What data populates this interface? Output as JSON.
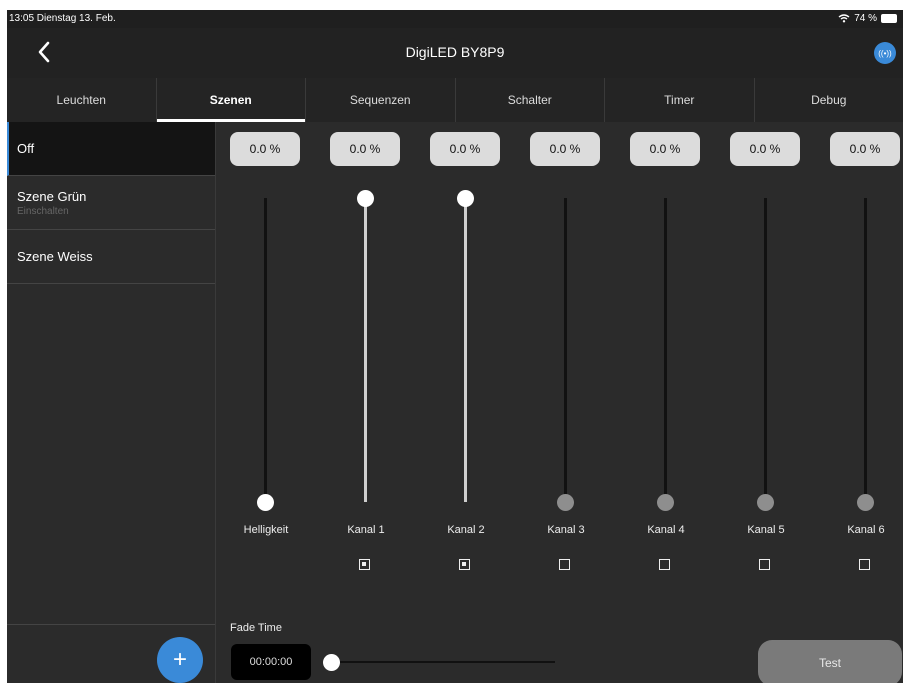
{
  "status_bar": {
    "time_date": "13:05  Dienstag 13. Feb.",
    "battery": "74 %"
  },
  "nav": {
    "title": "DigiLED BY8P9",
    "back_icon": "chevron-left-icon",
    "bluetooth_icon": "broadcast-icon",
    "bluetooth_label": "((•))"
  },
  "tabs": [
    "Leuchten",
    "Szenen",
    "Sequenzen",
    "Schalter",
    "Timer",
    "Debug"
  ],
  "active_tab": "Szenen",
  "scenes": [
    {
      "label": "Off",
      "sub": ""
    },
    {
      "label": "Szene Grün",
      "sub": "Einschalten"
    },
    {
      "label": "Szene Weiss",
      "sub": ""
    }
  ],
  "active_scene": "Off",
  "add_button": "+",
  "channels": [
    {
      "label": "Helligkeit",
      "value": "0.0 %",
      "level": 0,
      "enabled": true,
      "has_checkbox": false
    },
    {
      "label": "Kanal 1",
      "value": "0.0 %",
      "level": 1,
      "enabled": true,
      "has_checkbox": true,
      "checked": true
    },
    {
      "label": "Kanal 2",
      "value": "0.0 %",
      "level": 1,
      "enabled": true,
      "has_checkbox": true,
      "checked": true
    },
    {
      "label": "Kanal 3",
      "value": "0.0 %",
      "level": 0,
      "enabled": false,
      "has_checkbox": true,
      "checked": false
    },
    {
      "label": "Kanal 4",
      "value": "0.0 %",
      "level": 0,
      "enabled": false,
      "has_checkbox": true,
      "checked": false
    },
    {
      "label": "Kanal 5",
      "value": "0.0 %",
      "level": 0,
      "enabled": false,
      "has_checkbox": true,
      "checked": false
    },
    {
      "label": "Kanal 6",
      "value": "0.0 %",
      "level": 0,
      "enabled": false,
      "has_checkbox": true,
      "checked": false
    }
  ],
  "fade": {
    "label": "Fade Time",
    "value": "00:00:00",
    "level": 0
  },
  "test_button": "Test",
  "colors": {
    "accent": "#3a8ad8",
    "background": "#2b2b2b",
    "active_row": "#141414"
  }
}
